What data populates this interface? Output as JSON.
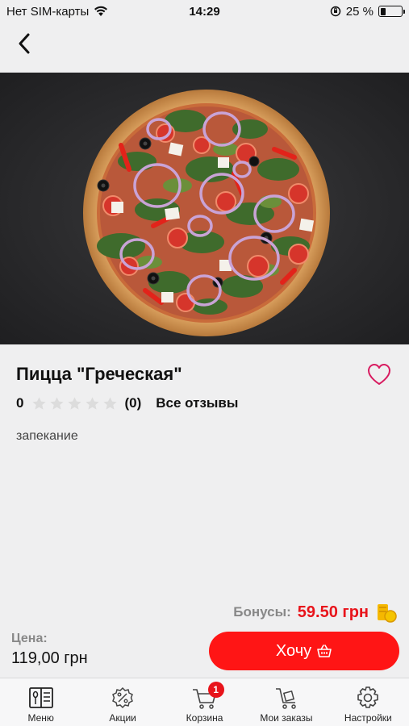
{
  "status_bar": {
    "carrier": "Нет SIM-карты",
    "time": "14:29",
    "battery_percent": "25 %",
    "battery_level": 0.25
  },
  "nav": {
    "back_icon": "chevron-left-icon"
  },
  "product": {
    "title": "Пицца \"Греческая\"",
    "rating_value": "0",
    "stars_filled": 0,
    "stars_total": 5,
    "reviews_count": "(0)",
    "reviews_link": "Все отзывы",
    "description": "запекание",
    "favorite_icon": "heart-outline-icon"
  },
  "order": {
    "bonus_label": "Бонусы:",
    "bonus_value": "59.50 грн",
    "price_label": "Цена:",
    "price_value": "119,00 грн",
    "want_label": "Хочу",
    "want_icon": "basket-icon"
  },
  "tabs": [
    {
      "label": "Меню",
      "icon": "menu-book-icon"
    },
    {
      "label": "Акции",
      "icon": "discount-icon"
    },
    {
      "label": "Корзина",
      "icon": "cart-icon",
      "badge": "1"
    },
    {
      "label": "Мои заказы",
      "icon": "orders-cart-icon"
    },
    {
      "label": "Настройки",
      "icon": "settings-gear-icon"
    }
  ],
  "colors": {
    "accent": "#ff1515",
    "bonus": "#e8141b",
    "background": "#efeff0"
  }
}
